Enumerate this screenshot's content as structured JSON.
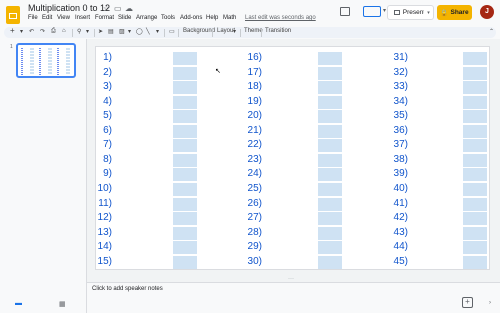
{
  "app": {
    "title": "Multiplication 0 to 12",
    "menus": [
      "File",
      "Edit",
      "View",
      "Insert",
      "Format",
      "Slide",
      "Arrange",
      "Tools",
      "Add-ons",
      "Help",
      "Math"
    ],
    "last_edit": "Last edit was seconds ago",
    "present_label": "Present",
    "share_label": "Share",
    "avatar_letter": "J"
  },
  "toolbar": {
    "background": "Background",
    "layout": "Layout",
    "theme": "Theme",
    "transition": "Transition"
  },
  "filmstrip": {
    "slide_number": "1"
  },
  "slide": {
    "columns": [
      [
        "1)",
        "2)",
        "3)",
        "4)",
        "5)",
        "6)",
        "7)",
        "8)",
        "9)",
        "10)",
        "11)",
        "12)",
        "13)",
        "14)",
        "15)"
      ],
      [
        "16)",
        "17)",
        "18)",
        "19)",
        "20)",
        "21)",
        "22)",
        "23)",
        "24)",
        "25)",
        "26)",
        "27)",
        "28)",
        "29)",
        "30)"
      ],
      [
        "31)",
        "32)",
        "33)",
        "34)",
        "35)",
        "36)",
        "37)",
        "38)",
        "39)",
        "40)",
        "41)",
        "42)",
        "43)",
        "44)",
        "45)"
      ]
    ]
  },
  "notes": {
    "placeholder": "Click to add speaker notes"
  },
  "colors": {
    "accent": "#4285f4",
    "label": "#1155cc",
    "answer_box": "#cfe2f3",
    "share": "#f4b400"
  }
}
